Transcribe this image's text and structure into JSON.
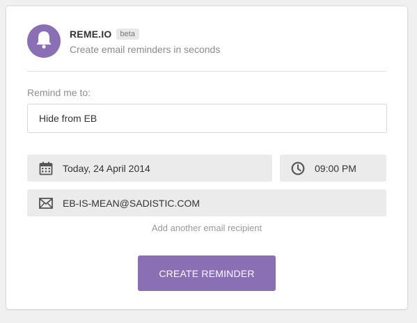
{
  "app": {
    "name": "REME.IO",
    "badge": "beta",
    "tagline": "Create email reminders in seconds",
    "logo_icon": "bell-icon"
  },
  "form": {
    "remind_label": "Remind me to:",
    "task_value": "Hide from EB",
    "date_value": "Today, 24 April 2014",
    "date_icon": "calendar-icon",
    "time_value": "09:00 PM",
    "time_icon": "clock-icon",
    "email_value": "EB-IS-MEAN@SADISTIC.COM",
    "email_icon": "envelope-icon",
    "add_recipient_label": "Add another email recipient",
    "submit_label": "CREATE REMINDER"
  },
  "colors": {
    "accent": "#8a6fb5",
    "page_background": "#f0f0f0",
    "field_background": "#ebebeb"
  }
}
